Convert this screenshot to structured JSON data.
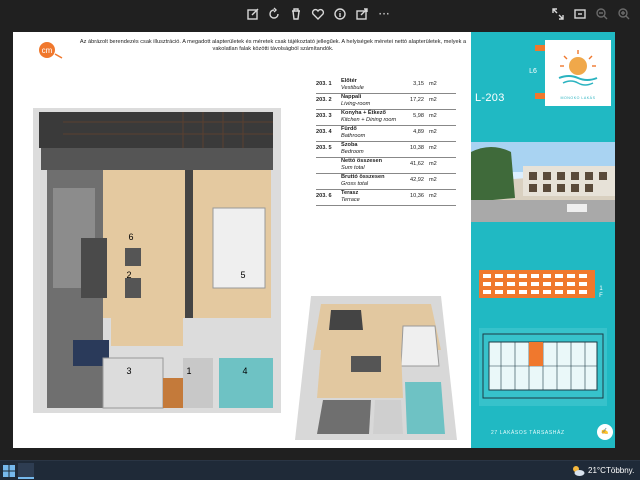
{
  "toolbar": {
    "icons": [
      "edit-icon",
      "rotate-icon",
      "delete-icon",
      "heart-icon",
      "info-icon",
      "share-icon",
      "more-icon",
      "fullscreen-icon",
      "slideshow-icon",
      "zoom-out-icon",
      "zoom-in-icon"
    ],
    "more_label": "···"
  },
  "document": {
    "disclaimer": "Az ábrázolt berendezés csak illusztráció. A megadott alapterületek és méretek csak tájékoztató jellegűek. A helyiségek méretei nettó alapterületek, melyek a vakolatlan falak közötti távolságból számítandók.",
    "logo_text": "cm",
    "rooms": [
      {
        "code": "203. 1",
        "name": "Előtér",
        "sub": "Vestibule",
        "area": "3,15",
        "unit": "m2"
      },
      {
        "code": "203. 2",
        "name": "Nappali",
        "sub": "Living-room",
        "area": "17,22",
        "unit": "m2"
      },
      {
        "code": "203. 3",
        "name": "Konyha + Étkező",
        "sub": "Kitchen + Dining room",
        "area": "5,98",
        "unit": "m2"
      },
      {
        "code": "203. 4",
        "name": "Fürdő",
        "sub": "Bathroom",
        "area": "4,89",
        "unit": "m2"
      },
      {
        "code": "203. 5",
        "name": "Szoba",
        "sub": "Bedroom",
        "area": "10,38",
        "unit": "m2"
      },
      {
        "code": "",
        "name": "Nettó összesen",
        "sub": "Sum total",
        "area": "41,62",
        "unit": "m2"
      },
      {
        "code": "",
        "name": "Bruttó összesen",
        "sub": "Gross total",
        "area": "42,92",
        "unit": "m2"
      },
      {
        "code": "203. 6",
        "name": "Terasz",
        "sub": "Terrace",
        "area": "10,36",
        "unit": "m2"
      }
    ],
    "plan_labels": [
      "6",
      "2",
      "5",
      "3",
      "1",
      "4"
    ],
    "panel": {
      "unit_label": "L-203",
      "badge_label": "L6",
      "floor_markers": [
        "1",
        "F"
      ],
      "footer": "27 LAKÁSOS TÁRSASHÁZ",
      "brand_sub": "MONOKO LAKÁS",
      "color": "#20b9c3",
      "accent": "#f0782d"
    }
  },
  "taskbar": {
    "temperature": "21°C",
    "weather_desc": "Többny."
  }
}
